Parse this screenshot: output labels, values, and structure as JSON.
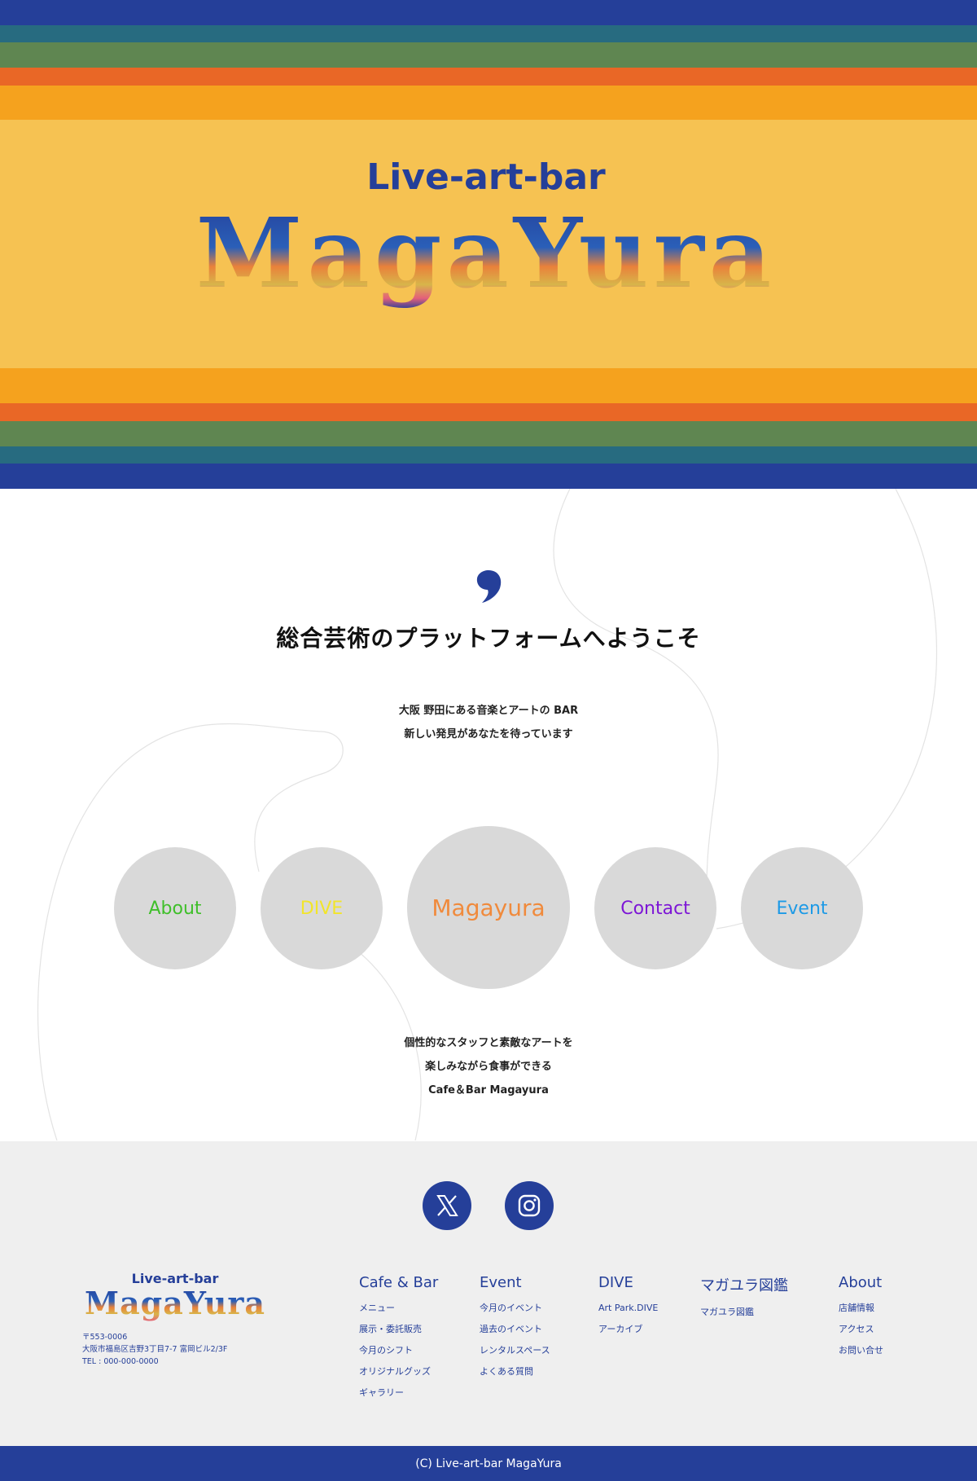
{
  "colors": {
    "navy": "#253f99",
    "teal": "#276b80",
    "green": "#5f8651",
    "orange": "#e96726",
    "amber": "#f5a21e",
    "gold": "#f6c252",
    "footer_bg": "#efefef",
    "circle_bg": "#d9d9d9"
  },
  "hero": {
    "tagline": "Live-art-bar",
    "logo_text": "MagaYura"
  },
  "main": {
    "headline": "総合芸術のプラットフォームへようこそ",
    "intro": [
      "大阪 野田にある音楽とアートの BAR",
      "新しい発見があなたを待っています"
    ],
    "nav_circles": [
      {
        "label": "About",
        "color": "#3fbf2a"
      },
      {
        "label": "DIVE",
        "color": "#f2e52a"
      },
      {
        "label": "Magayura",
        "color": "#f08a3c"
      },
      {
        "label": "Contact",
        "color": "#7d16d6"
      },
      {
        "label": "Event",
        "color": "#1d9ae6"
      }
    ],
    "outro": [
      "個性的なスタッフと素敵なアートを",
      "楽しみながら食事ができる",
      "Cafe＆Bar Magayura"
    ]
  },
  "footer": {
    "social": [
      {
        "icon": "x-logo-icon"
      },
      {
        "icon": "instagram-icon"
      }
    ],
    "logo_tagline": "Live-art-bar",
    "logo_text": "MagaYura",
    "address": [
      "〒553-0006",
      "大阪市福島区吉野3丁目7-7 富岡ビル2/3F",
      "TEL : 000-000-0000"
    ],
    "columns": [
      {
        "title": "Cafe & Bar",
        "links": [
          "メニュー",
          "展示・委託販売",
          "今月のシフト",
          "オリジナルグッズ",
          "ギャラリー"
        ]
      },
      {
        "title": "Event",
        "links": [
          "今月のイベント",
          "過去のイベント",
          "レンタルスペース",
          "よくある質問"
        ]
      },
      {
        "title": "DIVE",
        "links": [
          "Art Park.DIVE",
          "アーカイブ"
        ]
      },
      {
        "title": "マガユラ図鑑",
        "links": [
          "マガユラ図鑑"
        ]
      },
      {
        "title": "About",
        "links": [
          "店舗情報",
          "アクセス",
          "お問い合せ"
        ]
      }
    ],
    "copyright": "(C)  Live-art-bar MagaYura"
  }
}
